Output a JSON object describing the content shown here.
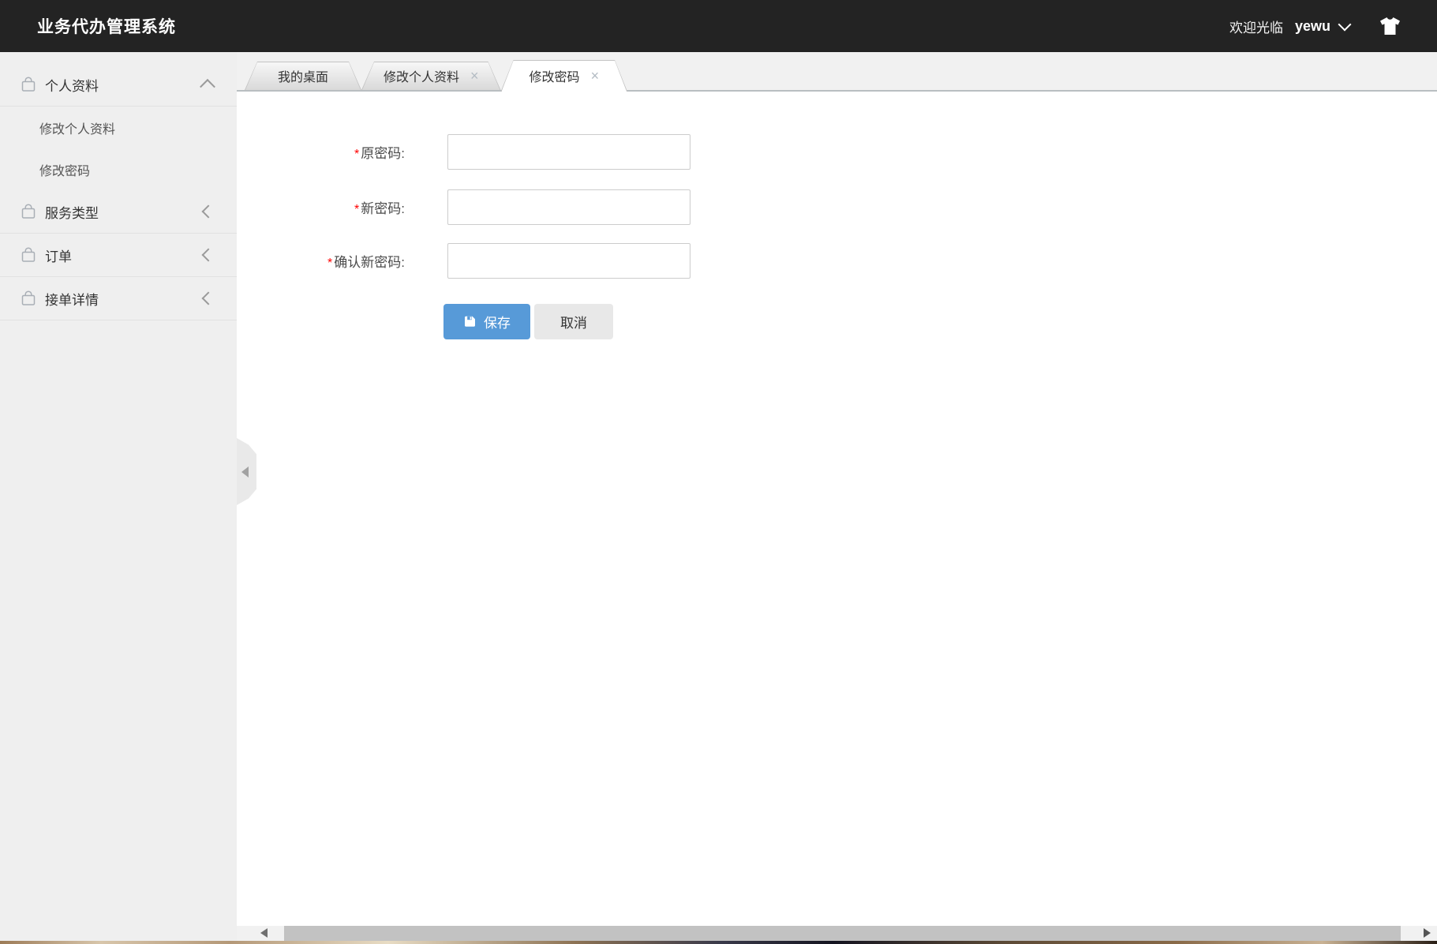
{
  "header": {
    "title": "业务代办管理系统",
    "welcome_text": "欢迎光临",
    "username": "yewu"
  },
  "sidebar": {
    "items": [
      {
        "label": "个人资料",
        "state": "expanded",
        "children": [
          {
            "label": "修改个人资料"
          },
          {
            "label": "修改密码"
          }
        ]
      },
      {
        "label": "服务类型",
        "state": "collapsed"
      },
      {
        "label": "订单",
        "state": "collapsed"
      },
      {
        "label": "接单详情",
        "state": "collapsed"
      }
    ]
  },
  "tabs": {
    "items": [
      {
        "label": "我的桌面",
        "active": false
      },
      {
        "label": "修改个人资料",
        "close": "×",
        "active": false
      },
      {
        "label": "修改密码",
        "close": "×",
        "active": true
      }
    ]
  },
  "form": {
    "required_mark": "*",
    "fields": [
      {
        "label": "原密码:",
        "value": ""
      },
      {
        "label": "新密码:",
        "value": ""
      },
      {
        "label": "确认新密码:",
        "value": ""
      }
    ],
    "save_label": "保存",
    "cancel_label": "取消"
  },
  "colors": {
    "accent_blue": "#579ad8",
    "header_bg": "#232323",
    "sidebar_bg": "#efefef",
    "tab_strip_bg": "#f1f1f1",
    "scrollbar_thumb": "#c2c2c2"
  }
}
